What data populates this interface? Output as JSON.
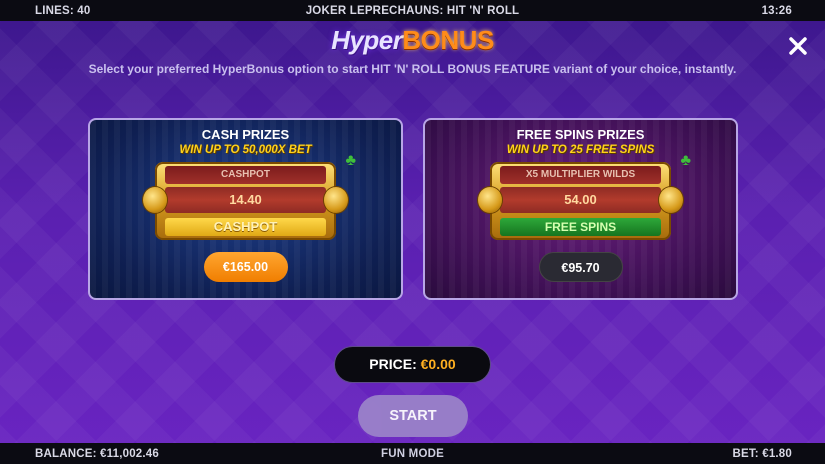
{
  "topbar": {
    "lines": "LINES: 40",
    "title": "JOKER LEPRECHAUNS: HIT 'N' ROLL",
    "time": "13:26"
  },
  "logo": {
    "hyper": "Hyper",
    "bonus": "BONUS"
  },
  "subtitle": "Select your preferred HyperBonus option to start HIT 'N' ROLL BONUS FEATURE variant of your choice, instantly.",
  "cards": {
    "cash": {
      "title": "CASH PRIZES",
      "sub": "WIN UP TO 50,000X BET",
      "top_row": "CASHPOT",
      "mid_value": "14.40",
      "bottom_row": "CASHPOT",
      "price": "€165.00"
    },
    "free": {
      "title": "FREE SPINS PRIZES",
      "sub": "WIN UP TO 25 FREE SPINS",
      "top_row": "X5 MULTIPLIER WILDS",
      "mid_value": "54.00",
      "bottom_row": "FREE SPINS",
      "price": "€95.70"
    }
  },
  "total": {
    "label": "PRICE: ",
    "value": "€0.00"
  },
  "start_label": "START",
  "bottombar": {
    "balance": "BALANCE: €11,002.46",
    "mode": "FUN MODE",
    "bet": "BET: €1.80"
  },
  "colors": {
    "accent": "#ff8c1a",
    "price_value": "#ffb020",
    "cash_pill": "#f07e00"
  }
}
